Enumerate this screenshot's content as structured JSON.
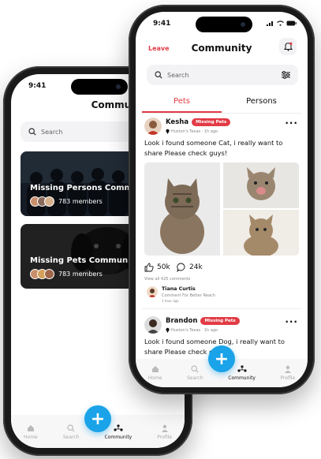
{
  "back_phone": {
    "time": "9:41",
    "title": "Community",
    "search_placeholder": "Search",
    "communities": [
      {
        "title": "Missing Persons Community",
        "members": "783 members"
      },
      {
        "title": "Missing Pets Community",
        "members": "783 members"
      }
    ],
    "nav": [
      "Home",
      "Search",
      "Community",
      "Profile"
    ],
    "fab": "+"
  },
  "front_phone": {
    "time": "9:41",
    "leave": "Leave",
    "title": "Community",
    "search_placeholder": "Search",
    "tabs": [
      "Pets",
      "Persons"
    ],
    "post1": {
      "author": "Kesha",
      "badge": "Missing Pets",
      "meta": "Huston's Texas · 1h ago",
      "text": "Look i found someone Cat, i really want to share Please check guys!",
      "likes": "50k",
      "comments": "24k",
      "view_all": "View all 425 comments",
      "commenter": "Tiana Curtis",
      "comment": "Comment For Better Reach",
      "comment_time": "1 hour ago"
    },
    "post2": {
      "author": "Brandon",
      "badge": "Missing Pets",
      "meta": "Huston's Texas · 1h ago",
      "text": "Look i found someone Dog, i really want to share Please check guys!"
    },
    "nav": [
      "Home",
      "Search",
      "Community",
      "Profile"
    ],
    "fab": "+"
  },
  "colors": {
    "accent": "#e23b45",
    "fab": "#1aa3e8"
  }
}
